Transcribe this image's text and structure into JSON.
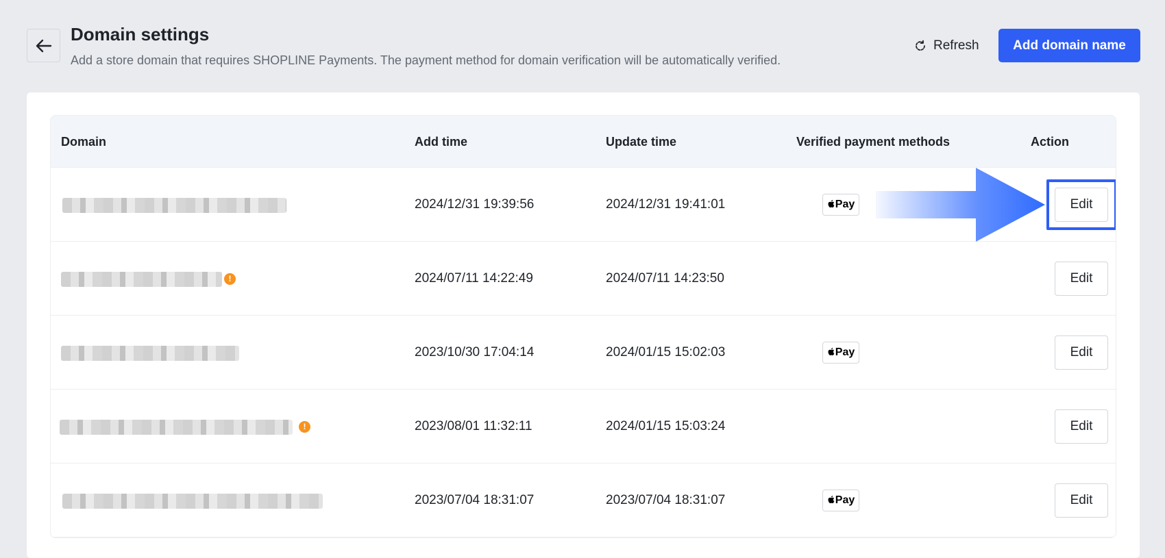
{
  "header": {
    "title": "Domain settings",
    "subtitle": "Add a store domain that requires SHOPLINE Payments. The payment method for domain verification will be automatically verified.",
    "back_icon": "arrow-left-icon",
    "refresh_label": "Refresh",
    "refresh_icon": "refresh-icon",
    "add_label": "Add domain name"
  },
  "table": {
    "columns": {
      "domain": "Domain",
      "add_time": "Add time",
      "update_time": "Update time",
      "verified": "Verified payment methods",
      "action": "Action"
    },
    "rows": [
      {
        "add_time": "2024/12/31 19:39:56",
        "update_time": "2024/12/31 19:41:01",
        "payment": "Pay",
        "edit_label": "Edit",
        "warning": false
      },
      {
        "add_time": "2024/07/11 14:22:49",
        "update_time": "2024/07/11 14:23:50",
        "payment": "",
        "edit_label": "Edit",
        "warning": true
      },
      {
        "add_time": "2023/10/30 17:04:14",
        "update_time": "2024/01/15 15:02:03",
        "payment": "Pay",
        "edit_label": "Edit",
        "warning": false
      },
      {
        "add_time": "2023/08/01 11:32:11",
        "update_time": "2024/01/15 15:03:24",
        "payment": "",
        "edit_label": "Edit",
        "warning": true
      },
      {
        "add_time": "2023/07/04 18:31:07",
        "update_time": "2023/07/04 18:31:07",
        "payment": "Pay",
        "edit_label": "Edit",
        "warning": false
      }
    ],
    "warning_glyph": "!"
  },
  "colors": {
    "accent": "#2f5ef5",
    "warning": "#f7931e",
    "page_bg": "#e9ebef"
  }
}
